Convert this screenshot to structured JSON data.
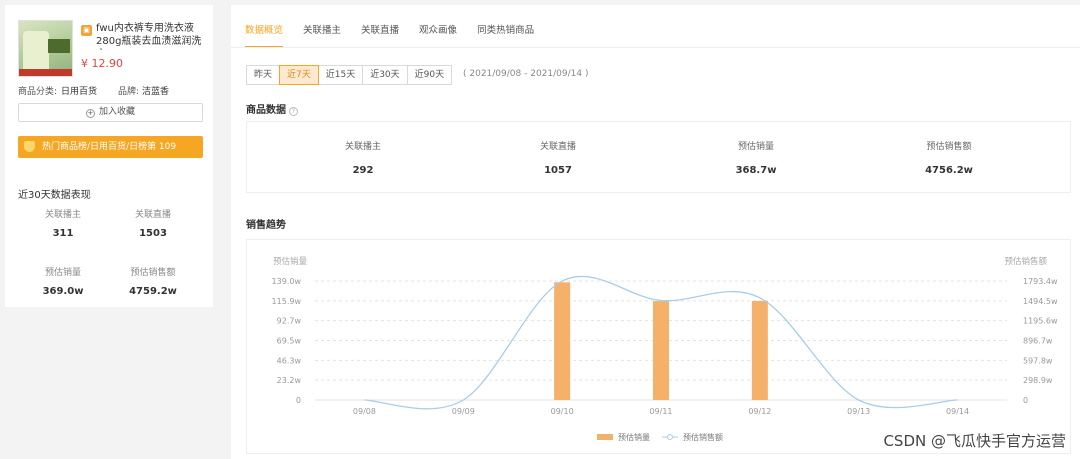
{
  "product": {
    "title": "fwu内衣裤专用洗衣液280g瓶装去血渍滋润洗衣...",
    "price": "¥ 12.90",
    "category_label": "商品分类:",
    "category_value": "日用百货",
    "brand_label": "品牌:",
    "brand_value": "洁蓝香",
    "favorite_button": "加入收藏",
    "hot_rank": "热门商品榜/日用百货/日榜第 109"
  },
  "recent30": {
    "title": "近30天数据表现",
    "stats": [
      {
        "label": "关联播主",
        "value": "311"
      },
      {
        "label": "关联直播",
        "value": "1503"
      },
      {
        "label": "预估销量",
        "value": "369.0w"
      },
      {
        "label": "预估销售额",
        "value": "4759.2w"
      }
    ]
  },
  "tabs": [
    "数据概览",
    "关联播主",
    "关联直播",
    "观众画像",
    "同类热销商品"
  ],
  "active_tab": 0,
  "ranges": [
    "昨天",
    "近7天",
    "近15天",
    "近30天",
    "近90天"
  ],
  "active_range": 1,
  "date_range": "( 2021/09/08 - 2021/09/14 )",
  "goods_data": {
    "title": "商品数据",
    "stats": [
      {
        "label": "关联播主",
        "value": "292"
      },
      {
        "label": "关联直播",
        "value": "1057"
      },
      {
        "label": "预估销量",
        "value": "368.7w"
      },
      {
        "label": "预估销售额",
        "value": "4756.2w"
      }
    ]
  },
  "sales_trend_title": "销售趋势",
  "colors": {
    "accent": "#f5a623",
    "bar": "#f5b06a",
    "line": "#a9cdea"
  },
  "chart_data": {
    "type": "bar+line",
    "categories": [
      "09/08",
      "09/09",
      "09/10",
      "09/11",
      "09/12",
      "09/13",
      "09/14"
    ],
    "y_left_label": "预估销量",
    "y_right_label": "预估销售额",
    "y_left_ticks": [
      "0",
      "23.2w",
      "46.3w",
      "69.5w",
      "92.7w",
      "115.9w",
      "139.0w"
    ],
    "y_right_ticks": [
      "0",
      "298.9w",
      "597.8w",
      "896.7w",
      "1195.6w",
      "1494.5w",
      "1793.4w"
    ],
    "ylim_left": [
      0,
      139.0
    ],
    "ylim_right": [
      0,
      1793.4
    ],
    "series": [
      {
        "name": "预估销量",
        "type": "bar",
        "values": [
          0,
          0,
          137.5,
          115.5,
          115.7,
          0,
          0
        ]
      },
      {
        "name": "预估销售额",
        "type": "line",
        "values": [
          0,
          0,
          1793,
          1500,
          1540,
          0,
          0
        ]
      }
    ],
    "grid": true,
    "legend": "bottom-center"
  },
  "watermark": "CSDN @飞瓜快手官方运营"
}
